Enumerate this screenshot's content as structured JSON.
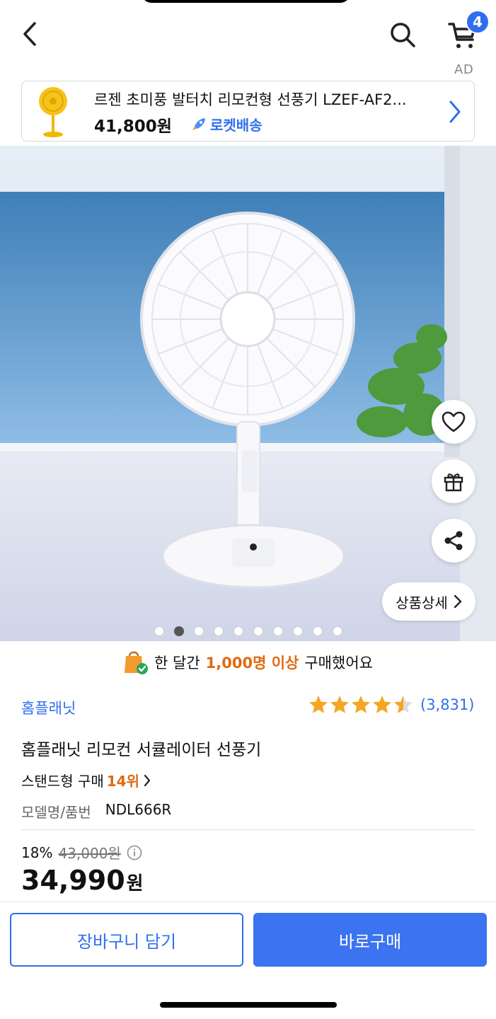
{
  "header": {
    "cart_count": "4"
  },
  "ad": {
    "label": "AD",
    "title": "르젠 초미풍 발터치 리모컨형 선풍기 LZEF-AF2...",
    "price": "41,800원",
    "delivery": "로켓배송"
  },
  "gallery": {
    "detail_button": "상품상세",
    "page_count": 10,
    "active_page": 2
  },
  "purchase_banner": {
    "prefix": "한 달간",
    "highlight": "1,000명 이상",
    "suffix": "구매했어요"
  },
  "product": {
    "brand": "홈플래닛",
    "rating_value": 4.5,
    "review_count": "(3,831)",
    "title": "홈플래닛 리모컨 서큘레이터 선풍기",
    "rank_label": "스탠드형 구매",
    "rank_number": "14위",
    "model_label": "모델명/품번",
    "model_value": "NDL666R",
    "discount": "18%",
    "original_price": "43,000원",
    "price": "34,990",
    "price_unit": "원"
  },
  "actions": {
    "add_to_cart": "장바구니 담기",
    "buy_now": "바로구매"
  },
  "colors": {
    "accent": "#2f6fef",
    "highlight": "#e06a12",
    "star": "#f5a623"
  }
}
